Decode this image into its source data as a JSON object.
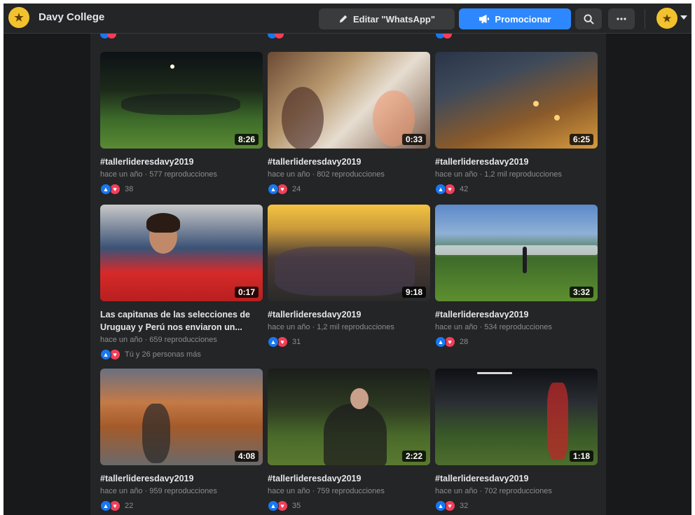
{
  "header": {
    "page_name": "Davy College",
    "edit_label": "Editar \"WhatsApp\"",
    "promote_label": "Promocionar"
  },
  "icons": {
    "edit": "pencil-icon",
    "promote": "megaphone-icon",
    "search": "search-icon",
    "more": "more-icon",
    "menu": "caret-down-icon",
    "like": "like-icon",
    "love": "love-icon"
  },
  "colors": {
    "background": "#18191a",
    "surface": "#242526",
    "accent": "#2d88ff",
    "like": "#1877f2",
    "love": "#f33e58"
  },
  "videos": [
    {
      "title": "#tallerlideresdavy2019",
      "duration": "8:26",
      "age": "hace un año",
      "views": "577 reproducciones",
      "reactions": "38"
    },
    {
      "title": "#tallerlideresdavy2019",
      "duration": "0:33",
      "age": "hace un año",
      "views": "802 reproducciones",
      "reactions": "24"
    },
    {
      "title": "#tallerlideresdavy2019",
      "duration": "6:25",
      "age": "hace un año",
      "views": "1,2 mil reproducciones",
      "reactions": "42"
    },
    {
      "title": "Las capitanas de las selecciones de Uruguay y Perú nos enviaron un...",
      "duration": "0:17",
      "age": "hace un año",
      "views": "659 reproducciones",
      "reactions": "Tú y 26 personas más"
    },
    {
      "title": "#tallerlideresdavy2019",
      "duration": "9:18",
      "age": "hace un año",
      "views": "1,2 mil reproducciones",
      "reactions": "31"
    },
    {
      "title": "#tallerlideresdavy2019",
      "duration": "3:32",
      "age": "hace un año",
      "views": "534 reproducciones",
      "reactions": "28"
    },
    {
      "title": "#tallerlideresdavy2019",
      "duration": "4:08",
      "age": "hace un año",
      "views": "959 reproducciones",
      "reactions": "22"
    },
    {
      "title": "#tallerlideresdavy2019",
      "duration": "2:22",
      "age": "hace un año",
      "views": "759 reproducciones",
      "reactions": "35"
    },
    {
      "title": "#tallerlideresdavy2019",
      "duration": "1:18",
      "age": "hace un año",
      "views": "702 reproducciones",
      "reactions": "32"
    }
  ]
}
